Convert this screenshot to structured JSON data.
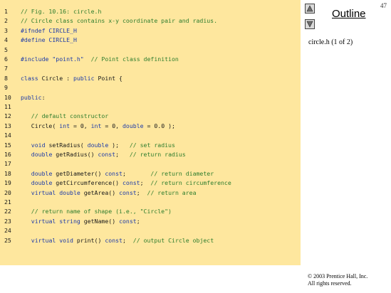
{
  "page_number": "47",
  "nav": {
    "up_icon": "triangle-up-icon",
    "down_icon": "triangle-down-icon"
  },
  "outline_label": "Outline",
  "caption": "circle.h (1 of 2)",
  "copyright": {
    "line1": "© 2003 Prentice Hall, Inc.",
    "line2": "All rights reserved."
  },
  "colors": {
    "code_background": "#fee79e",
    "comment": "#2e7d2e",
    "keyword": "#1c3aa9"
  },
  "code_lines": [
    {
      "num": "1",
      "segments": [
        {
          "t": "// Fig. 10.16: circle.h",
          "c": "cmt"
        }
      ]
    },
    {
      "num": "2",
      "segments": [
        {
          "t": "// Circle class contains x-y coordinate pair and radius.",
          "c": "cmt"
        }
      ]
    },
    {
      "num": "3",
      "segments": [
        {
          "t": "#ifndef CIRCLE_H",
          "c": "pre"
        }
      ]
    },
    {
      "num": "4",
      "segments": [
        {
          "t": "#define CIRCLE_H",
          "c": "pre"
        }
      ]
    },
    {
      "num": "5",
      "segments": []
    },
    {
      "num": "6",
      "segments": [
        {
          "t": "#include ",
          "c": "pre"
        },
        {
          "t": "\"point.h\"",
          "c": "str"
        },
        {
          "t": "  ",
          "c": ""
        },
        {
          "t": "// Point class definition",
          "c": "cmt"
        }
      ]
    },
    {
      "num": "7",
      "segments": []
    },
    {
      "num": "8",
      "segments": [
        {
          "t": "class",
          "c": "kw"
        },
        {
          "t": " Circle : ",
          "c": ""
        },
        {
          "t": "public",
          "c": "kw"
        },
        {
          "t": " Point {",
          "c": ""
        }
      ]
    },
    {
      "num": "9",
      "segments": []
    },
    {
      "num": "10",
      "segments": [
        {
          "t": "public",
          "c": "kw"
        },
        {
          "t": ":",
          "c": ""
        }
      ]
    },
    {
      "num": "11",
      "segments": []
    },
    {
      "num": "12",
      "segments": [
        {
          "t": "   ",
          "c": ""
        },
        {
          "t": "// default constructor",
          "c": "cmt"
        }
      ]
    },
    {
      "num": "13",
      "segments": [
        {
          "t": "   Circle( ",
          "c": ""
        },
        {
          "t": "int",
          "c": "kw"
        },
        {
          "t": " = 0, ",
          "c": ""
        },
        {
          "t": "int",
          "c": "kw"
        },
        {
          "t": " = 0, ",
          "c": ""
        },
        {
          "t": "double",
          "c": "kw"
        },
        {
          "t": " = 0.0 );",
          "c": ""
        }
      ]
    },
    {
      "num": "14",
      "segments": []
    },
    {
      "num": "15",
      "segments": [
        {
          "t": "   ",
          "c": ""
        },
        {
          "t": "void",
          "c": "kw"
        },
        {
          "t": " setRadius( ",
          "c": ""
        },
        {
          "t": "double",
          "c": "kw"
        },
        {
          "t": " );   ",
          "c": ""
        },
        {
          "t": "// set radius",
          "c": "cmt"
        }
      ]
    },
    {
      "num": "16",
      "segments": [
        {
          "t": "   ",
          "c": ""
        },
        {
          "t": "double",
          "c": "kw"
        },
        {
          "t": " getRadius() ",
          "c": ""
        },
        {
          "t": "const",
          "c": "kw"
        },
        {
          "t": ";   ",
          "c": ""
        },
        {
          "t": "// return radius",
          "c": "cmt"
        }
      ]
    },
    {
      "num": "17",
      "segments": []
    },
    {
      "num": "18",
      "segments": [
        {
          "t": "   ",
          "c": ""
        },
        {
          "t": "double",
          "c": "kw"
        },
        {
          "t": " getDiameter() ",
          "c": ""
        },
        {
          "t": "const",
          "c": "kw"
        },
        {
          "t": ";       ",
          "c": ""
        },
        {
          "t": "// return diameter",
          "c": "cmt"
        }
      ]
    },
    {
      "num": "19",
      "segments": [
        {
          "t": "   ",
          "c": ""
        },
        {
          "t": "double",
          "c": "kw"
        },
        {
          "t": " getCircumference() ",
          "c": ""
        },
        {
          "t": "const",
          "c": "kw"
        },
        {
          "t": ";  ",
          "c": ""
        },
        {
          "t": "// return circumference",
          "c": "cmt"
        }
      ]
    },
    {
      "num": "20",
      "segments": [
        {
          "t": "   ",
          "c": ""
        },
        {
          "t": "virtual",
          "c": "kw"
        },
        {
          "t": " ",
          "c": ""
        },
        {
          "t": "double",
          "c": "kw"
        },
        {
          "t": " getArea() ",
          "c": ""
        },
        {
          "t": "const",
          "c": "kw"
        },
        {
          "t": ";  ",
          "c": ""
        },
        {
          "t": "// return area",
          "c": "cmt"
        }
      ]
    },
    {
      "num": "21",
      "segments": []
    },
    {
      "num": "22",
      "segments": [
        {
          "t": "   ",
          "c": ""
        },
        {
          "t": "// return name of shape (i.e., \"Circle\")",
          "c": "cmt"
        }
      ]
    },
    {
      "num": "23",
      "segments": [
        {
          "t": "   ",
          "c": ""
        },
        {
          "t": "virtual",
          "c": "kw"
        },
        {
          "t": " ",
          "c": ""
        },
        {
          "t": "string",
          "c": "kw"
        },
        {
          "t": " getName() ",
          "c": ""
        },
        {
          "t": "const",
          "c": "kw"
        },
        {
          "t": ";",
          "c": ""
        }
      ]
    },
    {
      "num": "24",
      "segments": []
    },
    {
      "num": "25",
      "segments": [
        {
          "t": "   ",
          "c": ""
        },
        {
          "t": "virtual",
          "c": "kw"
        },
        {
          "t": " ",
          "c": ""
        },
        {
          "t": "void",
          "c": "kw"
        },
        {
          "t": " print() ",
          "c": ""
        },
        {
          "t": "const",
          "c": "kw"
        },
        {
          "t": ";  ",
          "c": ""
        },
        {
          "t": "// output Circle object",
          "c": "cmt"
        }
      ]
    }
  ]
}
